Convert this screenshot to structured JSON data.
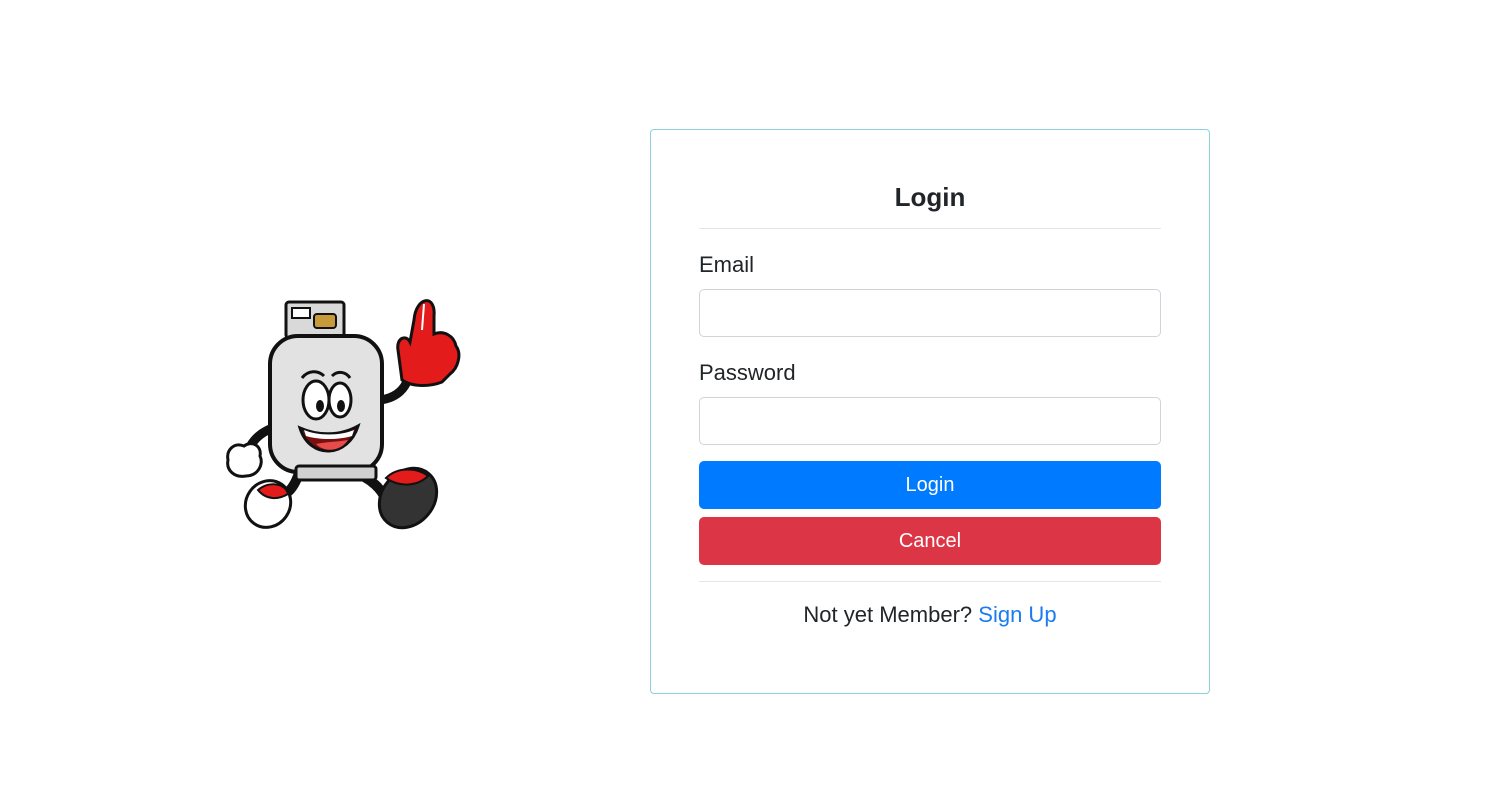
{
  "mascot": {
    "icon": "propane-tank-mascot-icon"
  },
  "login_form": {
    "title": "Login",
    "email_label": "Email",
    "email_value": "",
    "password_label": "Password",
    "password_value": "",
    "login_button": "Login",
    "cancel_button": "Cancel",
    "footer_text": "Not yet Member?",
    "signup_link": "Sign Up"
  },
  "colors": {
    "primary": "#007bff",
    "danger": "#dc3545",
    "link": "#1a7bf2",
    "card_border": "#8fcfdc"
  }
}
